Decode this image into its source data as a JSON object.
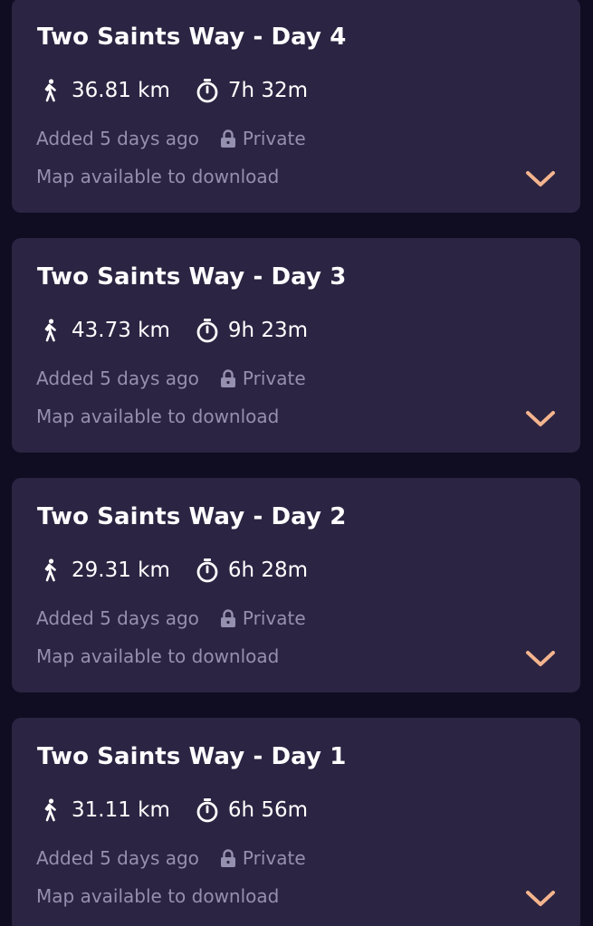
{
  "colors": {
    "background": "#100d22",
    "card": "#2b2442",
    "title": "#ffffff",
    "muted": "#9690b0",
    "accent": "#f4b48e"
  },
  "icons": {
    "distance": "walking-person-icon",
    "duration": "stopwatch-icon",
    "privacy": "lock-icon",
    "expand": "chevron-down-icon"
  },
  "routes": [
    {
      "title": "Two Saints Way - Day 4",
      "distance": "36.81 km",
      "duration": "7h 32m",
      "added": "Added 5 days ago",
      "privacy": "Private",
      "map_status": "Map available to download"
    },
    {
      "title": "Two Saints Way - Day 3",
      "distance": "43.73 km",
      "duration": "9h 23m",
      "added": "Added 5 days ago",
      "privacy": "Private",
      "map_status": "Map available to download"
    },
    {
      "title": "Two Saints Way - Day 2",
      "distance": "29.31 km",
      "duration": "6h 28m",
      "added": "Added 5 days ago",
      "privacy": "Private",
      "map_status": "Map available to download"
    },
    {
      "title": "Two Saints Way - Day 1",
      "distance": "31.11 km",
      "duration": "6h 56m",
      "added": "Added 5 days ago",
      "privacy": "Private",
      "map_status": "Map available to download"
    }
  ]
}
